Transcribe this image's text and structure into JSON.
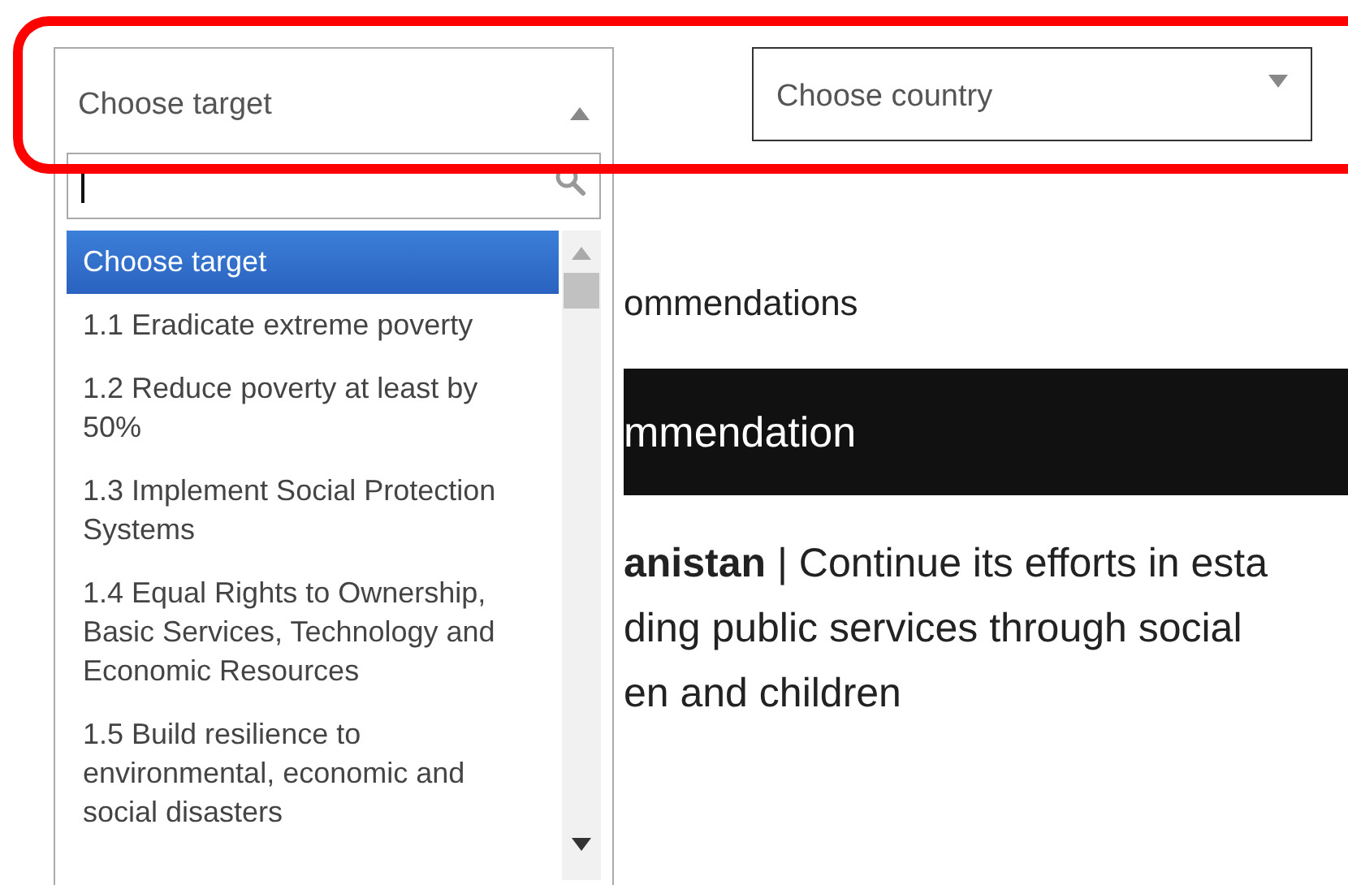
{
  "target_select": {
    "placeholder": "Choose target",
    "expanded": true,
    "options": [
      {
        "label": "Choose target",
        "selected": true
      },
      {
        "label": "1.1 Eradicate extreme poverty",
        "selected": false
      },
      {
        "label": "1.2 Reduce poverty at least by 50%",
        "selected": false
      },
      {
        "label": "1.3 Implement Social Protection Systems",
        "selected": false
      },
      {
        "label": "1.4 Equal Rights to Ownership, Basic Services, Technology and Economic Resources",
        "selected": false
      },
      {
        "label": "1.5 Build resilience to environmental, economic and social disasters",
        "selected": false
      }
    ]
  },
  "country_select": {
    "placeholder": "Choose country",
    "expanded": false
  },
  "content": {
    "heading": "ommendations",
    "banner": "mmendation",
    "paragraph_lines": [
      "**anistan** | Continue its efforts in esta",
      "ding public services through social",
      "en and children"
    ]
  }
}
